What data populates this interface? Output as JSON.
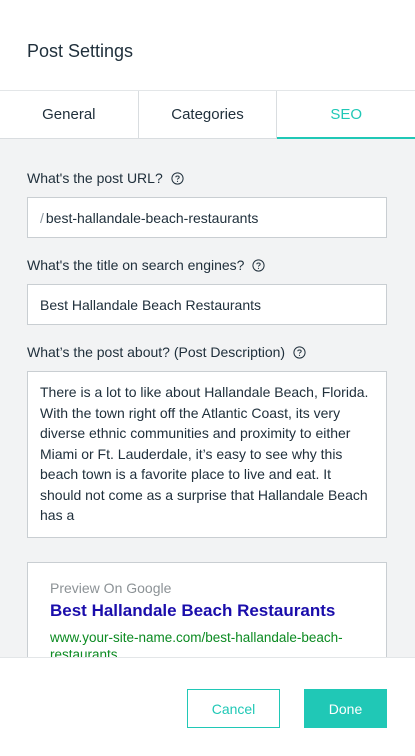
{
  "header": {
    "title": "Post Settings"
  },
  "tabs": [
    {
      "label": "General",
      "active": false
    },
    {
      "label": "Categories",
      "active": false
    },
    {
      "label": "SEO",
      "active": true
    }
  ],
  "seo": {
    "url_label": "What's the post URL?",
    "url_prefix": "/",
    "url_value": "best-hallandale-beach-restaurants",
    "title_label": "What's the title on search engines?",
    "title_value": "Best Hallandale Beach Restaurants",
    "description_label": "What’s the post about? (Post Description)",
    "description_value": "There is a lot to like about Hallandale Beach, Florida. With the town right off the Atlantic Coast, its very diverse ethnic communities and proximity to either Miami or Ft. Lauderdale, it’s easy to see why this beach town is a favorite place to live and eat. It should not come as a surprise that Hallandale Beach has a"
  },
  "preview": {
    "label": "Preview On Google",
    "title": "Best Hallandale Beach Restaurants",
    "url": "www.your-site-name.com/best-hallandale-beach-restaurants"
  },
  "footer": {
    "cancel_label": "Cancel",
    "done_label": "Done"
  },
  "colors": {
    "accent": "#20c8b6",
    "google_title": "#1a0dab",
    "google_url": "#0b8a21"
  },
  "icons": {
    "help": "question-circle-icon"
  }
}
